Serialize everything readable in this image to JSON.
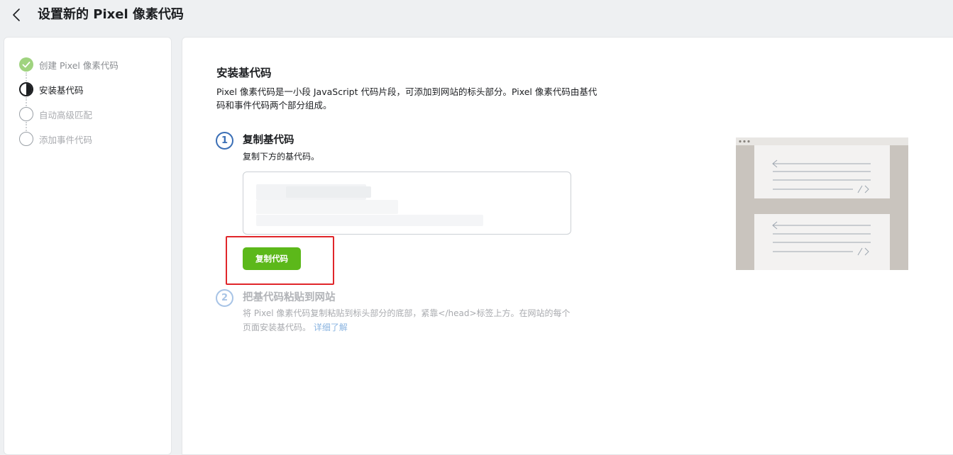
{
  "header": {
    "title": "设置新的 Pixel 像素代码",
    "back_icon": "chevron-left-icon"
  },
  "sidebar": {
    "steps": [
      {
        "label": "创建 Pixel 像素代码",
        "state": "done"
      },
      {
        "label": "安装基代码",
        "state": "current"
      },
      {
        "label": "自动高级匹配",
        "state": "todo"
      },
      {
        "label": "添加事件代码",
        "state": "todo"
      }
    ]
  },
  "main": {
    "title": "安装基代码",
    "description": "Pixel 像素代码是一小段 JavaScript 代码片段，可添加到网站的标头部分。Pixel 像素代码由基代码和事件代码两个部分组成。",
    "step1": {
      "number": "1",
      "title": "复制基代码",
      "description": "复制下方的基代码。",
      "button_label": "复制代码"
    },
    "step2": {
      "number": "2",
      "title": "把基代码粘贴到网站",
      "description": "将 Pixel 像素代码复制粘贴到标头部分的底部，紧靠</head>标签上方。在网站的每个页面安装基代码。",
      "link_label": "详细了解"
    }
  },
  "colors": {
    "accent_green": "#5cb81a",
    "step_blue": "#3b6fb6",
    "highlight_red": "#e0262a",
    "done_green": "#9fd37f"
  }
}
